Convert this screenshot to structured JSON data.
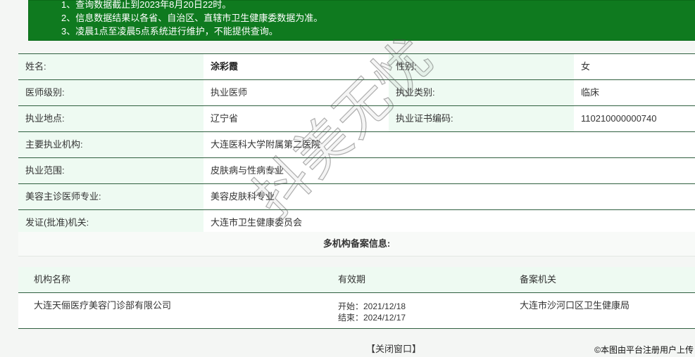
{
  "notice": {
    "line1": "1、查询数据截止到2023年8月20日22时。",
    "line2": "2、信息数据结果以各省、自治区、直辖市卫生健康委数据为准。",
    "line3": "3、凌晨1点至凌晨5点系统进行维护，不能提供查询。"
  },
  "doctor": {
    "name_label": "姓名:",
    "name_value": "涂彩霞",
    "gender_label": "性别:",
    "gender_value": "女",
    "level_label": "医师级别:",
    "level_value": "执业医师",
    "category_label": "执业类别:",
    "category_value": "临床",
    "location_label": "执业地点:",
    "location_value": "辽宁省",
    "cert_label": "执业证书编码:",
    "cert_value": "110210000000740",
    "org_label": "主要执业机构:",
    "org_value": "大连医科大学附属第二医院",
    "scope_label": "执业范围:",
    "scope_value": "皮肤病与性病专业",
    "cosmetic_label": "美容主诊医师专业:",
    "cosmetic_value": "美容皮肤科专业",
    "issuer_label": "发证(批准)机关:",
    "issuer_value": "大连市卫生健康委员会"
  },
  "multi_title": "多机构备案信息:",
  "records": {
    "headers": {
      "org": "机构名称",
      "validity": "有效期",
      "authority": "备案机关"
    },
    "rows": [
      {
        "org": "大连天俪医疗美容门诊部有限公司",
        "start": "开始：2021/12/18",
        "end": "结束：2024/12/17",
        "authority": "大连市沙河口区卫生健康局"
      }
    ]
  },
  "close_label": "【关闭窗口】",
  "credit": "©本图由平台注册用户上传",
  "watermark": "抖美无忧"
}
